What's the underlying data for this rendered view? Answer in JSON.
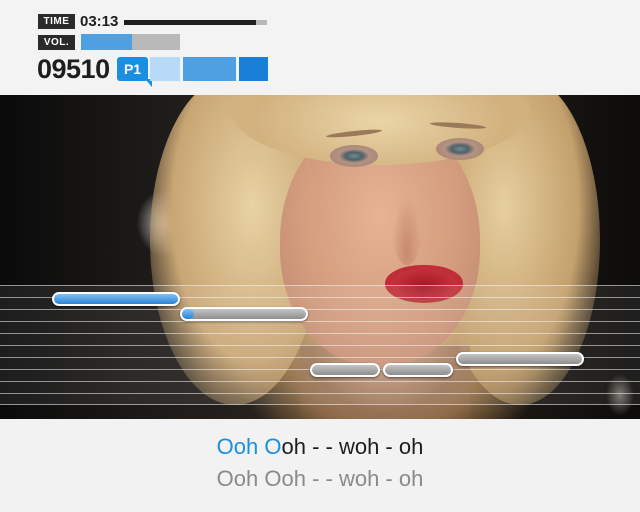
{
  "hud": {
    "time_label": "TIME",
    "time_value": "03:13",
    "time_progress": 0.92,
    "volume_label": "VOL.",
    "volume_level": 0.52,
    "score": "09510",
    "player_badge": "P1",
    "colors": {
      "accent": "#1a8ee0",
      "dark": "#1e1e1e"
    }
  },
  "lyrics": {
    "current_sung": "Ooh O",
    "current_rest": "oh - - woh - oh",
    "next_line": "Ooh Ooh - - woh - oh"
  },
  "notes": [
    {
      "state": "sung"
    },
    {
      "state": "in-progress",
      "progress": 0.1
    },
    {
      "state": "upcoming"
    },
    {
      "state": "upcoming"
    },
    {
      "state": "upcoming"
    }
  ]
}
